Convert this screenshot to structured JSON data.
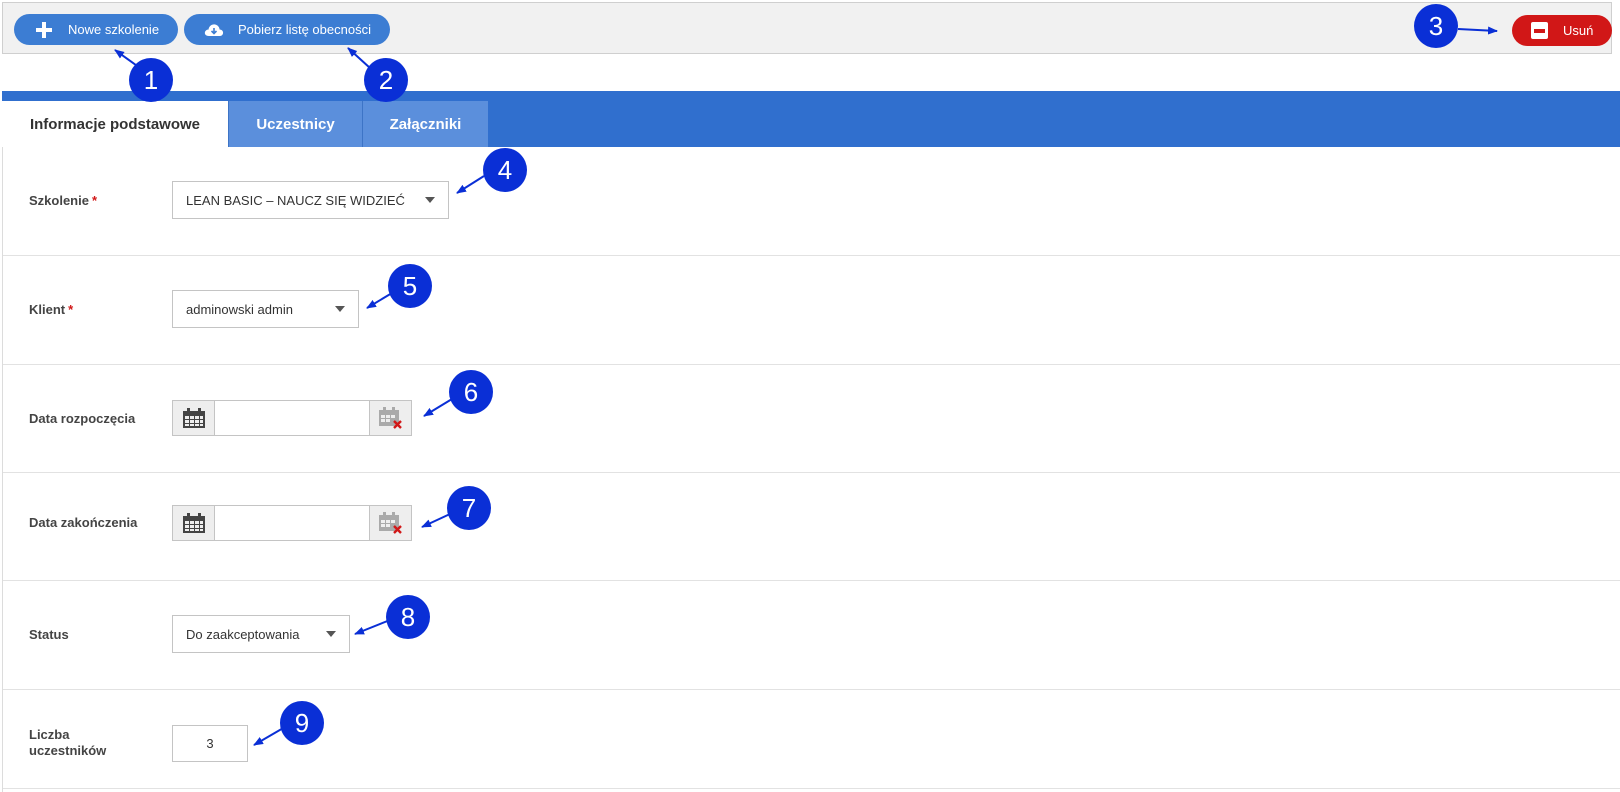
{
  "toolbar": {
    "new_training_label": "Nowe szkolenie",
    "download_attendance_label": "Pobierz listę obecności",
    "delete_label": "Usuń"
  },
  "tabs": [
    {
      "label": "Informacje podstawowe",
      "active": true
    },
    {
      "label": "Uczestnicy",
      "active": false
    },
    {
      "label": "Załączniki",
      "active": false
    }
  ],
  "form": {
    "training": {
      "label": "Szkolenie",
      "value": "LEAN BASIC – NAUCZ SIĘ WIDZIEĆ",
      "required_mark": "*"
    },
    "client": {
      "label": "Klient",
      "value": "adminowski admin",
      "required_mark": "*"
    },
    "start_date": {
      "label": "Data rozpoczęcia",
      "value": ""
    },
    "end_date": {
      "label": "Data zakończenia",
      "value": ""
    },
    "status": {
      "label": "Status",
      "value": "Do zaakceptowania"
    },
    "participants": {
      "label": "Liczba uczestników",
      "value": "3"
    }
  },
  "callouts": [
    "1",
    "2",
    "3",
    "4",
    "5",
    "6",
    "7",
    "8",
    "9"
  ],
  "colors": {
    "primary": "#3c7dd3",
    "tab_bar": "#306fce",
    "danger": "#d11717",
    "callout": "#0a2fd6"
  },
  "icons": {
    "new_training": "plus-icon",
    "download": "cloud-download-icon",
    "delete": "minus-square-icon",
    "calendar": "calendar-icon",
    "clear_date": "calendar-clear-icon",
    "dropdown": "caret-down-icon"
  }
}
